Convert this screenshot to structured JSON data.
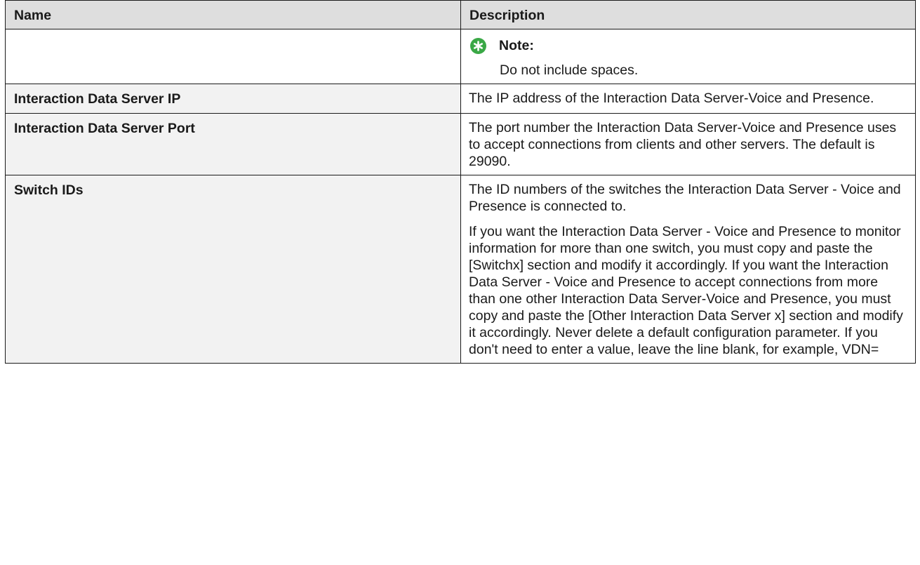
{
  "table": {
    "headers": {
      "name": "Name",
      "description": "Description"
    },
    "note": {
      "icon": "star-note-icon",
      "label": "Note:",
      "text": "Do not include spaces."
    },
    "rows": [
      {
        "name": "Interaction Data Server IP",
        "description": [
          "The IP address of the Interaction Data Server-Voice and Presence."
        ]
      },
      {
        "name": "Interaction Data Server Port",
        "description": [
          "The port number the Interaction Data Server-Voice and Presence uses to accept connections from clients and other servers. The default is 29090."
        ]
      },
      {
        "name": "Switch IDs",
        "description": [
          "The ID numbers of the switches the Interaction Data Server - Voice and Presence is connected to.",
          "If you want the Interaction Data Server - Voice and Presence to monitor information for more than one switch, you must copy and paste the [Switchx] section and modify it accordingly. If you want the Interaction Data Server - Voice and Presence to accept connections from more than one other Interaction Data Server-Voice and Presence, you must copy and paste the [Other Interaction Data Server x] section and modify it accordingly. Never delete a default configuration parameter. If you don't need to enter a value, leave the line blank, for example, VDN="
        ]
      }
    ],
    "colors": {
      "header_bg": "#dedede",
      "name_bg": "#f2f2f2",
      "note_icon": "#3aa846",
      "border": "#1a1a1a"
    }
  }
}
